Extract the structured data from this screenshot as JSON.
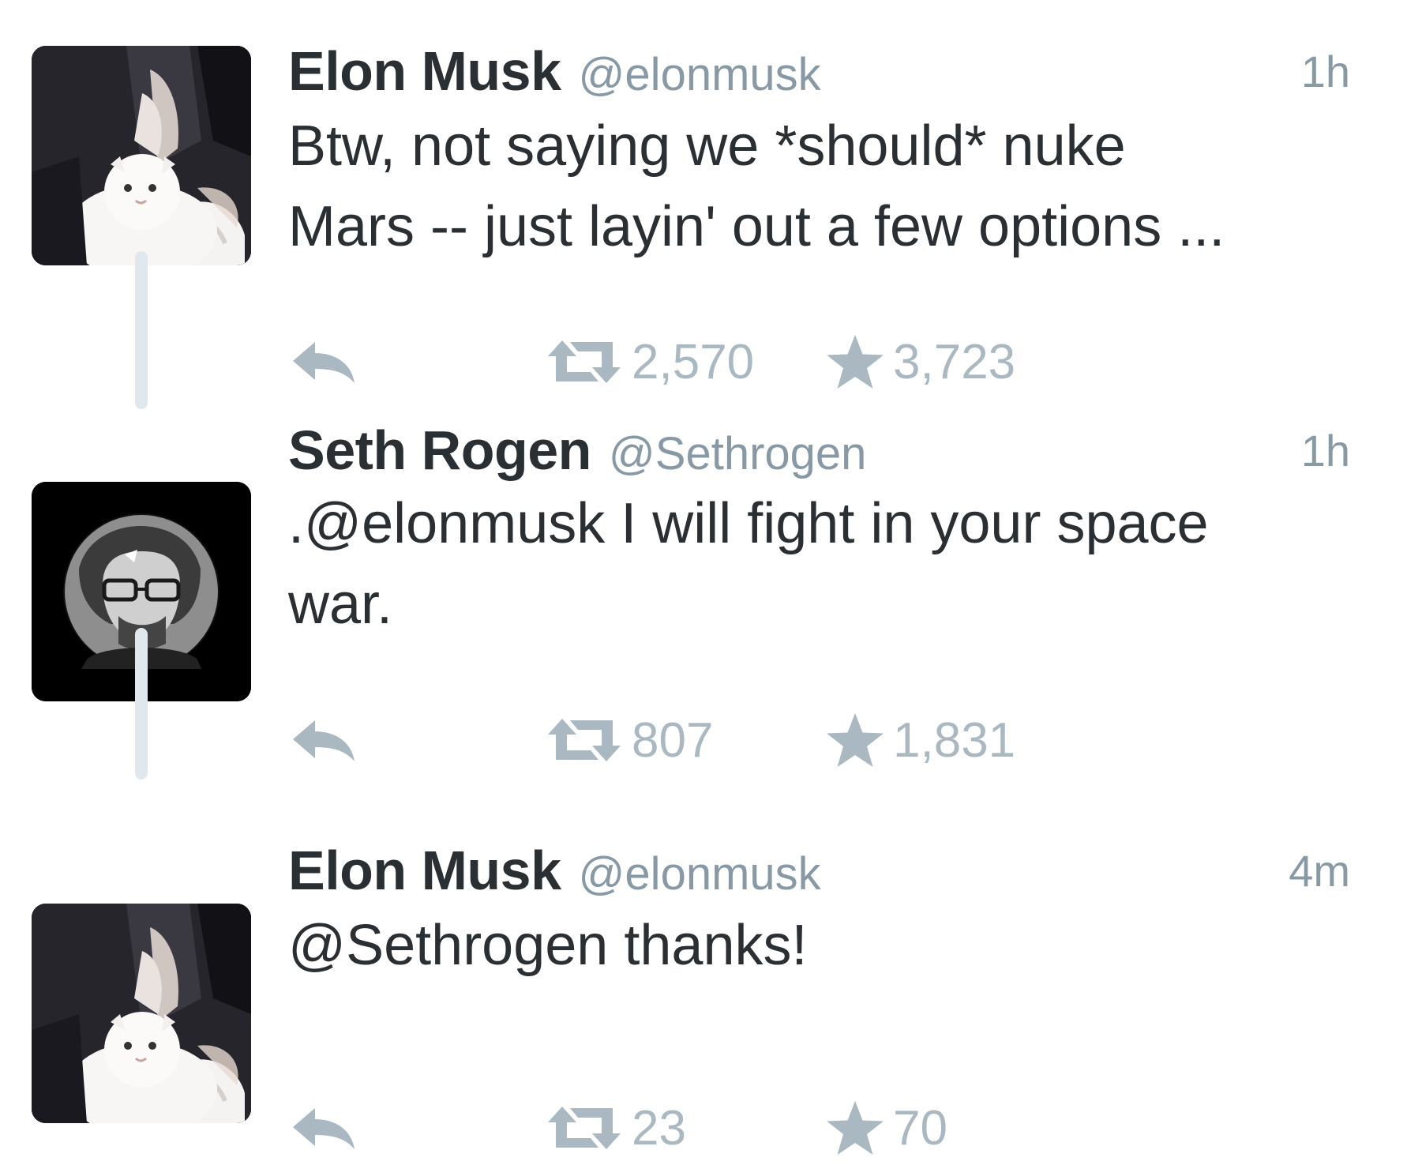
{
  "colors": {
    "name": "#292f33",
    "muted": "#8899a6",
    "action": "#aab8c2",
    "connector": "#e1e8ed"
  },
  "tweets": [
    {
      "name": "Elon Musk",
      "handle": "@elonmusk",
      "time": "1h",
      "text_lines": [
        "Btw, not saying we *should* nuke",
        "Mars -- just layin' out a few options ..."
      ],
      "retweets": "2,570",
      "favorites": "3,723",
      "avatar": "elon-avatar"
    },
    {
      "name": "Seth Rogen",
      "handle": "@Sethrogen",
      "time": "1h",
      "text_lines": [
        ".@elonmusk I will fight in your space",
        "war."
      ],
      "retweets": "807",
      "favorites": "1,831",
      "avatar": "seth-avatar"
    },
    {
      "name": "Elon Musk",
      "handle": "@elonmusk",
      "time": "4m",
      "text_lines": [
        "@Sethrogen thanks!"
      ],
      "retweets": "23",
      "favorites": "70",
      "avatar": "elon-avatar"
    }
  ],
  "icons": {
    "reply": "reply-icon",
    "retweet": "retweet-icon",
    "favorite": "star-icon"
  }
}
